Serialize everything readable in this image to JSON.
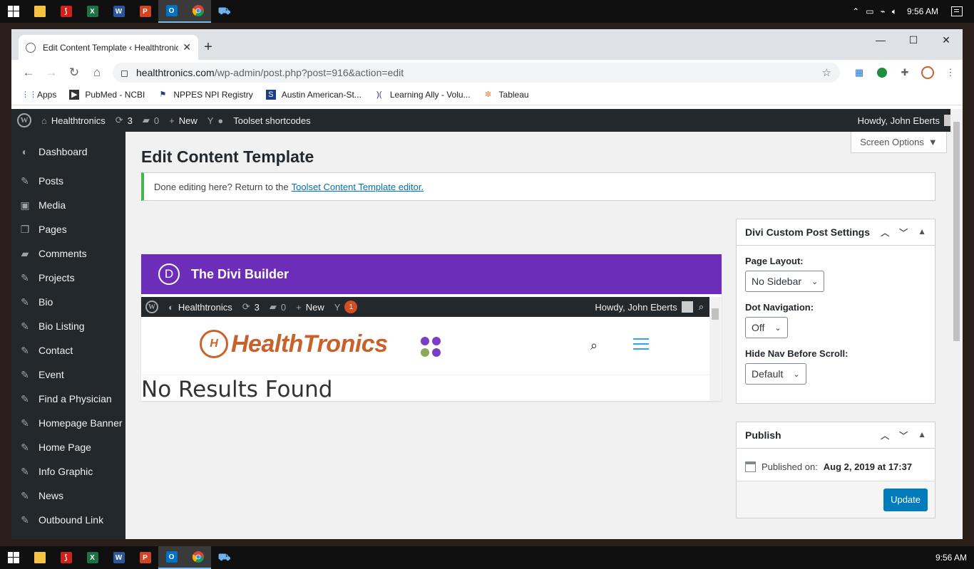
{
  "taskbar": {
    "apps": [
      {
        "name": "windows-start-icon",
        "color": "#ffffff",
        "glyph": ""
      },
      {
        "name": "file-explorer-icon",
        "color": "#f5c342",
        "glyph": ""
      },
      {
        "name": "adobe-acrobat-icon",
        "color": "#d0201c",
        "glyph": ""
      },
      {
        "name": "excel-icon",
        "color": "#1e7145",
        "glyph": "X"
      },
      {
        "name": "word-icon",
        "color": "#2b579a",
        "glyph": "W"
      },
      {
        "name": "powerpoint-icon",
        "color": "#d04423",
        "glyph": "P"
      },
      {
        "name": "outlook-icon",
        "color": "#0072c6",
        "glyph": "O"
      },
      {
        "name": "chrome-icon",
        "color": "#4285f4",
        "glyph": ""
      },
      {
        "name": "remote-desktop-icon",
        "color": "#2f7ccf",
        "glyph": ""
      }
    ],
    "time": "9:56 AM"
  },
  "browser": {
    "tab_title": "Edit Content Template ‹ Healthtronics",
    "url_host": "healthtronics.com",
    "url_path": "/wp-admin/post.php?post=916&action=edit",
    "bookmarks": [
      {
        "label": "Apps",
        "icon": "apps-grid-icon"
      },
      {
        "label": "PubMed - NCBI",
        "icon": "pubmed-icon"
      },
      {
        "label": "NPPES NPI Registry",
        "icon": "nppes-icon"
      },
      {
        "label": "Austin American-St...",
        "icon": "statesman-icon"
      },
      {
        "label": "Learning Ally - Volu...",
        "icon": "learning-ally-icon"
      },
      {
        "label": "Tableau",
        "icon": "tableau-icon"
      }
    ]
  },
  "adminbar": {
    "site": "Healthtronics",
    "updates": "3",
    "comments": "0",
    "new": "New",
    "toolset": "Toolset shortcodes",
    "howdy": "Howdy, John Eberts"
  },
  "sidebar": {
    "items": [
      "Dashboard",
      "Posts",
      "Media",
      "Pages",
      "Comments",
      "Projects",
      "Bio",
      "Bio Listing",
      "Contact",
      "Event",
      "Find a Physician",
      "Homepage Banner",
      "Home Page",
      "Info Graphic",
      "News",
      "Outbound Link"
    ]
  },
  "main": {
    "title": "Edit Content Template",
    "screen_options": "Screen Options",
    "notice_text": "Done editing here? Return to the",
    "notice_link": "Toolset Content Template editor.",
    "divi_title": "The Divi Builder",
    "divi_logo": "D"
  },
  "preview": {
    "site": "Healthtronics",
    "updates": "3",
    "comments": "0",
    "new": "New",
    "badge": "1",
    "howdy": "Howdy, John Eberts",
    "logo_mark": "H",
    "logo_text_1": "Health",
    "logo_text_2": "Tronics",
    "no_results": "No Results Found"
  },
  "divi_settings": {
    "title": "Divi Custom Post Settings",
    "page_layout_label": "Page Layout:",
    "page_layout_value": "No Sidebar",
    "dot_nav_label": "Dot Navigation:",
    "dot_nav_value": "Off",
    "hide_nav_label": "Hide Nav Before Scroll:",
    "hide_nav_value": "Default"
  },
  "publish": {
    "title": "Publish",
    "published_label": "Published on:",
    "published_date": "Aug 2, 2019 at 17:37",
    "update_button": "Update"
  },
  "colors": {
    "divi_purple": "#6c2eb9",
    "wp_dark": "#23282d",
    "wp_blue": "#007cba",
    "notice_green": "#46b450",
    "brand_orange": "#c9622a"
  }
}
